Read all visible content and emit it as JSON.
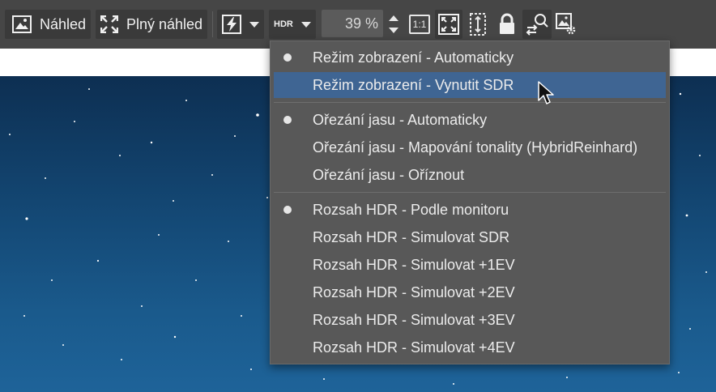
{
  "toolbar": {
    "preview_label": "Náhled",
    "full_preview_label": "Plný náhled",
    "hdr_label": "HDR",
    "zoom_value": "39 %",
    "one_to_one_label": "1:1"
  },
  "menu": {
    "groups": [
      {
        "items": [
          {
            "label": "Režim zobrazení - Automaticky",
            "checked": true
          },
          {
            "label": "Režim zobrazení - Vynutit SDR",
            "highlighted": true
          }
        ]
      },
      {
        "items": [
          {
            "label": "Ořezání jasu - Automaticky",
            "checked": true
          },
          {
            "label": "Ořezání jasu - Mapování tonality (HybridReinhard)"
          },
          {
            "label": "Ořezání jasu - Oříznout"
          }
        ]
      },
      {
        "items": [
          {
            "label": "Rozsah HDR - Podle monitoru",
            "checked": true
          },
          {
            "label": "Rozsah HDR - Simulovat SDR"
          },
          {
            "label": "Rozsah HDR - Simulovat +1EV"
          },
          {
            "label": "Rozsah HDR - Simulovat +2EV"
          },
          {
            "label": "Rozsah HDR - Simulovat +3EV"
          },
          {
            "label": "Rozsah HDR - Simulovat +4EV"
          }
        ]
      }
    ]
  },
  "colors": {
    "toolbar_bg": "#464646",
    "menu_bg": "#585858",
    "highlight": "#3f6593"
  },
  "icons": [
    "picture-icon",
    "fullscreen-icon",
    "flash-icon",
    "zoom-stepper-icon",
    "fit-to-screen-icon",
    "fit-height-icon",
    "lock-icon",
    "sync-zoom-icon",
    "image-settings-icon"
  ]
}
